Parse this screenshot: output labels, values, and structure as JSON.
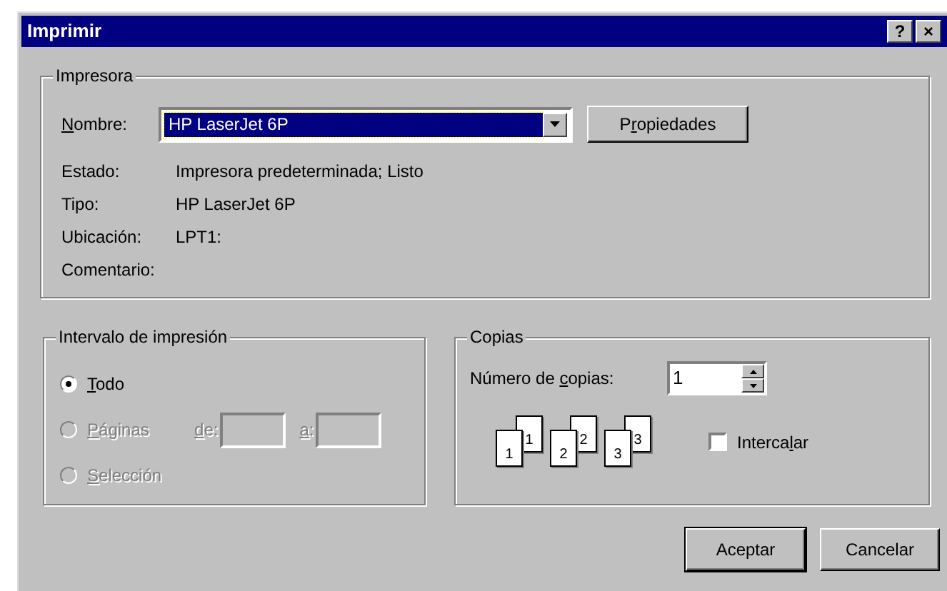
{
  "window": {
    "title": "Imprimir",
    "title_buttons": [
      "?",
      "×"
    ]
  },
  "printer": {
    "legend": "Impresora",
    "name_label": {
      "key": "N",
      "post": "ombre:"
    },
    "name_value": "HP LaserJet 6P",
    "properties_button": {
      "pre": "P",
      "key": "r",
      "post": "opiedades"
    },
    "info": [
      {
        "label": "Estado:",
        "value": "Impresora predeterminada; Listo"
      },
      {
        "label": "Tipo:",
        "value": "HP LaserJet 6P"
      },
      {
        "label": "Ubicación:",
        "value": "LPT1:"
      },
      {
        "label": "Comentario:"
      }
    ]
  },
  "range": {
    "legend": "Intervalo de impresión",
    "options": [
      {
        "label": {
          "key": "T",
          "post": "odo"
        },
        "selected": true,
        "disabled": false
      },
      {
        "label": {
          "key": "P",
          "post": "áginas"
        },
        "selected": false,
        "disabled": true,
        "from_label": {
          "key": "d",
          "post": "e:"
        },
        "to_label": {
          "key": "a",
          "post": ":"
        }
      },
      {
        "label": {
          "key": "S",
          "post": "elección"
        },
        "selected": false,
        "disabled": true
      }
    ]
  },
  "copies": {
    "legend": "Copias",
    "count_label": {
      "pre": "Número de ",
      "key": "c",
      "post": "opias:"
    },
    "count": "1",
    "pages": [
      {
        "back": "1",
        "front": "1"
      },
      {
        "back": "2",
        "front": "2"
      },
      {
        "back": "3",
        "front": "3"
      }
    ],
    "collate": {
      "label": {
        "pre": "Interca",
        "key": "l",
        "post": "ar"
      },
      "checked": false
    }
  },
  "buttons": [
    {
      "label": "Aceptar",
      "default": true
    },
    {
      "label": "Cancelar",
      "default": false
    }
  ]
}
